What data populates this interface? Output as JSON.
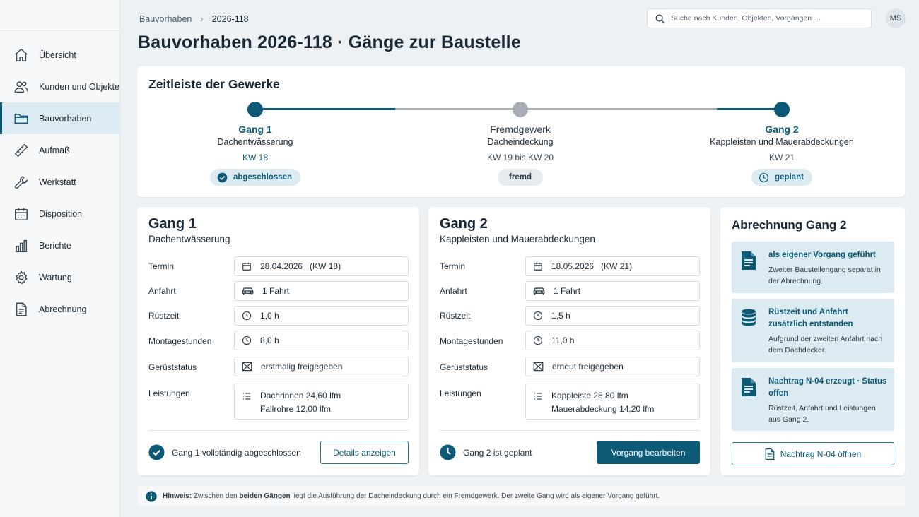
{
  "sidebar": {
    "items": [
      {
        "label": "Übersicht",
        "icon": "home-icon"
      },
      {
        "label": "Kunden und Objekte",
        "icon": "users-icon"
      },
      {
        "label": "Bauvorhaben",
        "icon": "folder-icon",
        "active": true
      },
      {
        "label": "Aufmaß",
        "icon": "ruler-icon"
      },
      {
        "label": "Werkstatt",
        "icon": "wrench-icon"
      },
      {
        "label": "Disposition",
        "icon": "calendar-icon"
      },
      {
        "label": "Berichte",
        "icon": "bar-chart-icon"
      },
      {
        "label": "Wartung",
        "icon": "gear-icon"
      },
      {
        "label": "Abrechnung",
        "icon": "document-icon"
      }
    ]
  },
  "header": {
    "breadcrumb": [
      "Bauvorhaben",
      "2026-118"
    ],
    "search_placeholder": "Suche nach Kunden, Objekten, Vorgängen …",
    "avatar_initials": "MS",
    "page_title": "Bauvorhaben 2026-118 · Gänge zur Baustelle"
  },
  "timeline": {
    "title": "Zeitleiste der Gewerke",
    "steps": [
      {
        "name": "Gang 1",
        "sub": "Dachentwässerung",
        "kw": "KW 18",
        "status": "abgeschlossen",
        "color": "#0d5a77"
      },
      {
        "name": "Fremdgewerk",
        "sub": "Dacheindeckung",
        "kw": "KW 19 bis KW 20",
        "status": "fremd",
        "color": "#a7adb2"
      },
      {
        "name": "Gang 2",
        "sub": "Kappleisten und Mauerabdeckungen",
        "kw": "KW 21",
        "status": "geplant",
        "color": "#0d5a77"
      }
    ]
  },
  "labels": {
    "termin": "Termin",
    "anfahrt": "Anfahrt",
    "ruestzeit": "Rüstzeit",
    "montage": "Montagestunden",
    "geruest": "Gerüststatus",
    "leistungen": "Leistungen"
  },
  "gang1": {
    "title": "Gang 1",
    "sub": "Dachentwässerung",
    "termin": "28.04.2026   (KW 18)",
    "anfahrt": "1 Fahrt",
    "ruestzeit": "1,0 h",
    "montage": "8,0 h",
    "geruest": "erstmalig freigegeben",
    "leistungen": [
      "Dachrinnen 24,60 lfm",
      "Fallrohre 12,00 lfm"
    ],
    "status_text": "Gang 1 vollständig abgeschlossen",
    "button": "Details anzeigen"
  },
  "gang2": {
    "title": "Gang 2",
    "sub": "Kappleisten und Mauerabdeckungen",
    "termin": "18.05.2026   (KW 21)",
    "anfahrt": "1 Fahrt",
    "ruestzeit": "1,5 h",
    "montage": "11,0 h",
    "geruest": "erneut freigegeben",
    "leistungen": [
      "Kappleiste 26,80 lfm",
      "Mauerabdeckung 14,20 lfm"
    ],
    "status_text": "Gang 2 ist geplant",
    "button": "Vorgang bearbeiten"
  },
  "billing": {
    "title": "Abrechnung Gang 2",
    "items": [
      {
        "title": "als eigener Vorgang geführt",
        "text": "Zweiter Baustellengang separat in der Abrechnung.",
        "icon": "document-icon"
      },
      {
        "title": "Rüstzeit und Anfahrt zusätzlich entstanden",
        "text": "Aufgrund der zweiten Anfahrt nach dem Dachdecker.",
        "icon": "coins-icon"
      },
      {
        "title": "Nachtrag N-04 erzeugt · Status offen",
        "text": "Rüstzeit, Anfahrt und Leistungen aus Gang 2.",
        "icon": "document-icon"
      }
    ],
    "button": "Nachtrag N-04 öffnen"
  },
  "hint": {
    "label": "Hinweis:",
    "text_a": "Zwischen den",
    "bold": "beiden Gängen",
    "text_b": "liegt die Ausführung der Dacheindeckung durch ein Fremdgewerk. Der zweite Gang wird als eigener Vorgang geführt."
  },
  "colors": {
    "primary": "#0d5a77",
    "primary_light": "#dcebf2",
    "neutral_dot": "#a7adb2"
  }
}
